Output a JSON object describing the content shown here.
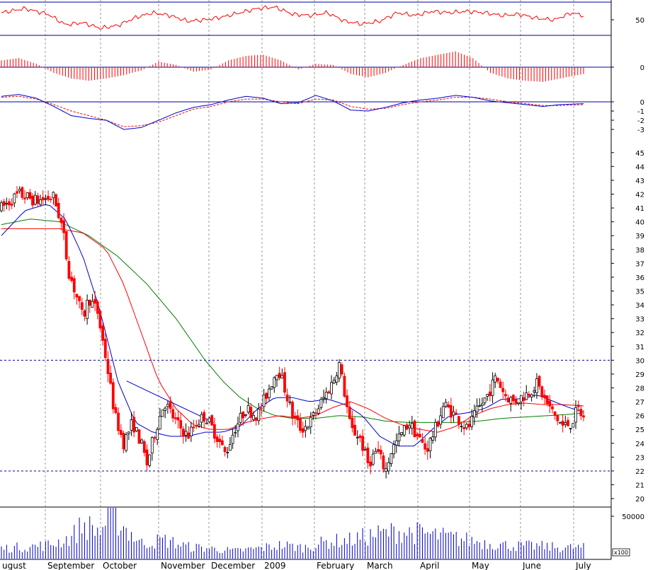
{
  "chart_data": {
    "type": "candlestick",
    "months": [
      "ugust",
      "September",
      "October",
      "November",
      "December",
      "2009",
      "February",
      "March",
      "April",
      "May",
      "June",
      "July"
    ],
    "price_axis": {
      "range": [
        19.8,
        45.5
      ],
      "ticks": [
        "45",
        "44",
        "43",
        "42",
        "41",
        "40",
        "39",
        "38",
        "37",
        "36",
        "35",
        "34",
        "33",
        "32",
        "31",
        "30",
        "29",
        "28",
        "27",
        "26",
        "25",
        "24",
        "23",
        "22",
        "21",
        "20"
      ],
      "support": 22,
      "resistance": 30
    },
    "price_path": [
      {
        "t": 0,
        "v": 41.0
      },
      {
        "t": 3,
        "v": 42.0
      },
      {
        "t": 6,
        "v": 41.5
      },
      {
        "t": 9,
        "v": 41.8
      },
      {
        "t": 10.5,
        "v": 39.5
      },
      {
        "t": 11.5,
        "v": 36.5
      },
      {
        "t": 13,
        "v": 34.5
      },
      {
        "t": 14,
        "v": 33.0
      },
      {
        "t": 15,
        "v": 34.5
      },
      {
        "t": 16.5,
        "v": 33.5
      },
      {
        "t": 18,
        "v": 30.0
      },
      {
        "t": 19.5,
        "v": 26.0
      },
      {
        "t": 21,
        "v": 24.0
      },
      {
        "t": 22.5,
        "v": 25.5
      },
      {
        "t": 24,
        "v": 24.0
      },
      {
        "t": 25,
        "v": 22.5
      },
      {
        "t": 26.5,
        "v": 25.0
      },
      {
        "t": 28,
        "v": 27.0
      },
      {
        "t": 30,
        "v": 25.5
      },
      {
        "t": 32,
        "v": 24.5
      },
      {
        "t": 33.5,
        "v": 25.5
      },
      {
        "t": 35,
        "v": 26.0
      },
      {
        "t": 37,
        "v": 24.5
      },
      {
        "t": 38.5,
        "v": 23.2
      },
      {
        "t": 40,
        "v": 25.0
      },
      {
        "t": 42,
        "v": 26.5
      },
      {
        "t": 44,
        "v": 26.0
      },
      {
        "t": 46,
        "v": 28.0
      },
      {
        "t": 47.5,
        "v": 29.5
      },
      {
        "t": 49,
        "v": 27.5
      },
      {
        "t": 50,
        "v": 26.0
      },
      {
        "t": 51.5,
        "v": 25.0
      },
      {
        "t": 53,
        "v": 25.5
      },
      {
        "t": 55,
        "v": 27.0
      },
      {
        "t": 57,
        "v": 28.5
      },
      {
        "t": 58,
        "v": 29.8
      },
      {
        "t": 59,
        "v": 27.5
      },
      {
        "t": 60,
        "v": 25.0
      },
      {
        "t": 61.5,
        "v": 24.5
      },
      {
        "t": 63,
        "v": 22.5
      },
      {
        "t": 64.5,
        "v": 23.5
      },
      {
        "t": 66,
        "v": 22.0
      },
      {
        "t": 67,
        "v": 23.5
      },
      {
        "t": 68.5,
        "v": 24.5
      },
      {
        "t": 70,
        "v": 25.5
      },
      {
        "t": 71.5,
        "v": 24.5
      },
      {
        "t": 73,
        "v": 23.5
      },
      {
        "t": 74.5,
        "v": 25.0
      },
      {
        "t": 76,
        "v": 26.8
      },
      {
        "t": 78,
        "v": 26.0
      },
      {
        "t": 80,
        "v": 25.0
      },
      {
        "t": 82,
        "v": 26.5
      },
      {
        "t": 83.5,
        "v": 27.5
      },
      {
        "t": 85,
        "v": 28.8
      },
      {
        "t": 86.5,
        "v": 27.5
      },
      {
        "t": 88,
        "v": 27.0
      },
      {
        "t": 90,
        "v": 27.5
      },
      {
        "t": 92,
        "v": 28.3
      },
      {
        "t": 93.5,
        "v": 27.0
      },
      {
        "t": 95,
        "v": 26.0
      },
      {
        "t": 96.5,
        "v": 25.2
      },
      {
        "t": 98,
        "v": 25.5
      },
      {
        "t": 99,
        "v": 26.5
      },
      {
        "t": 100,
        "v": 25.8
      }
    ],
    "ma_short": [
      {
        "t": 0,
        "v": 39.0
      },
      {
        "t": 4,
        "v": 40.8
      },
      {
        "t": 8,
        "v": 41.3
      },
      {
        "t": 11,
        "v": 40.2
      },
      {
        "t": 14,
        "v": 37.5
      },
      {
        "t": 17,
        "v": 33.5
      },
      {
        "t": 20,
        "v": 28.5
      },
      {
        "t": 23,
        "v": 25.5
      },
      {
        "t": 26,
        "v": 24.8
      },
      {
        "t": 29,
        "v": 24.5
      },
      {
        "t": 32,
        "v": 24.5
      },
      {
        "t": 35,
        "v": 24.8
      },
      {
        "t": 38,
        "v": 24.8
      },
      {
        "t": 41,
        "v": 25.2
      },
      {
        "t": 44,
        "v": 26.5
      },
      {
        "t": 47,
        "v": 27.3
      },
      {
        "t": 50,
        "v": 27.3
      },
      {
        "t": 53,
        "v": 27.0
      },
      {
        "t": 56,
        "v": 27.2
      },
      {
        "t": 59,
        "v": 26.8
      },
      {
        "t": 62,
        "v": 26.0
      },
      {
        "t": 65,
        "v": 24.5
      },
      {
        "t": 68,
        "v": 23.8
      },
      {
        "t": 71,
        "v": 23.8
      },
      {
        "t": 74,
        "v": 25.0
      },
      {
        "t": 77,
        "v": 26.0
      },
      {
        "t": 80,
        "v": 26.2
      },
      {
        "t": 83,
        "v": 26.5
      },
      {
        "t": 86,
        "v": 27.2
      },
      {
        "t": 89,
        "v": 27.2
      },
      {
        "t": 92,
        "v": 27.5
      },
      {
        "t": 95,
        "v": 27.0
      },
      {
        "t": 98,
        "v": 26.5
      },
      {
        "t": 100,
        "v": 26.3
      }
    ],
    "ma_mid": [
      {
        "t": 0,
        "v": 39.5
      },
      {
        "t": 5,
        "v": 39.5
      },
      {
        "t": 10,
        "v": 39.5
      },
      {
        "t": 14,
        "v": 39.2
      },
      {
        "t": 18,
        "v": 38.0
      },
      {
        "t": 21,
        "v": 35.5
      },
      {
        "t": 24,
        "v": 32.0
      },
      {
        "t": 27,
        "v": 28.5
      },
      {
        "t": 30,
        "v": 26.5
      },
      {
        "t": 33,
        "v": 25.3
      },
      {
        "t": 36,
        "v": 25.0
      },
      {
        "t": 39,
        "v": 25.0
      },
      {
        "t": 42,
        "v": 25.5
      },
      {
        "t": 45,
        "v": 25.8
      },
      {
        "t": 48,
        "v": 26.0
      },
      {
        "t": 51,
        "v": 25.8
      },
      {
        "t": 54,
        "v": 26.0
      },
      {
        "t": 57,
        "v": 26.6
      },
      {
        "t": 60,
        "v": 27.0
      },
      {
        "t": 63,
        "v": 26.5
      },
      {
        "t": 66,
        "v": 25.8
      },
      {
        "t": 69,
        "v": 25.3
      },
      {
        "t": 72,
        "v": 25.0
      },
      {
        "t": 75,
        "v": 24.8
      },
      {
        "t": 78,
        "v": 25.2
      },
      {
        "t": 81,
        "v": 26.0
      },
      {
        "t": 84,
        "v": 26.5
      },
      {
        "t": 87,
        "v": 26.8
      },
      {
        "t": 90,
        "v": 26.9
      },
      {
        "t": 93,
        "v": 26.8
      },
      {
        "t": 96,
        "v": 26.8
      },
      {
        "t": 100,
        "v": 26.7
      }
    ],
    "ma_long": [
      {
        "t": 0,
        "v": 39.8
      },
      {
        "t": 5,
        "v": 40.2
      },
      {
        "t": 10,
        "v": 40.0
      },
      {
        "t": 15,
        "v": 39.0
      },
      {
        "t": 20,
        "v": 37.5
      },
      {
        "t": 25,
        "v": 35.5
      },
      {
        "t": 30,
        "v": 33.0
      },
      {
        "t": 35,
        "v": 30.0
      },
      {
        "t": 38,
        "v": 28.5
      },
      {
        "t": 41,
        "v": 27.3
      },
      {
        "t": 44,
        "v": 26.5
      },
      {
        "t": 47,
        "v": 26.0
      },
      {
        "t": 50,
        "v": 25.8
      },
      {
        "t": 54,
        "v": 25.8
      },
      {
        "t": 58,
        "v": 26.0
      },
      {
        "t": 62,
        "v": 25.9
      },
      {
        "t": 66,
        "v": 25.6
      },
      {
        "t": 70,
        "v": 25.5
      },
      {
        "t": 74,
        "v": 25.5
      },
      {
        "t": 78,
        "v": 25.5
      },
      {
        "t": 82,
        "v": 25.6
      },
      {
        "t": 86,
        "v": 25.8
      },
      {
        "t": 90,
        "v": 25.9
      },
      {
        "t": 94,
        "v": 26.0
      },
      {
        "t": 98,
        "v": 26.1
      },
      {
        "t": 100,
        "v": 26.2
      }
    ],
    "trendline": {
      "from": {
        "t": 21.5,
        "v": 28.5
      },
      "to": {
        "t": 36.5,
        "v": 25.5
      }
    },
    "rsi": {
      "levels": [
        "50"
      ],
      "path": [
        {
          "t": 0,
          "v": 62
        },
        {
          "t": 4,
          "v": 68
        },
        {
          "t": 8,
          "v": 60
        },
        {
          "t": 11,
          "v": 45
        },
        {
          "t": 14,
          "v": 48
        },
        {
          "t": 17,
          "v": 40
        },
        {
          "t": 20,
          "v": 44
        },
        {
          "t": 23,
          "v": 55
        },
        {
          "t": 26,
          "v": 62
        },
        {
          "t": 29,
          "v": 58
        },
        {
          "t": 32,
          "v": 50
        },
        {
          "t": 35,
          "v": 52
        },
        {
          "t": 38,
          "v": 56
        },
        {
          "t": 41,
          "v": 62
        },
        {
          "t": 44,
          "v": 68
        },
        {
          "t": 47,
          "v": 70
        },
        {
          "t": 50,
          "v": 60
        },
        {
          "t": 53,
          "v": 58
        },
        {
          "t": 56,
          "v": 62
        },
        {
          "t": 59,
          "v": 50
        },
        {
          "t": 62,
          "v": 46
        },
        {
          "t": 65,
          "v": 50
        },
        {
          "t": 68,
          "v": 62
        },
        {
          "t": 71,
          "v": 58
        },
        {
          "t": 74,
          "v": 64
        },
        {
          "t": 77,
          "v": 62
        },
        {
          "t": 80,
          "v": 64
        },
        {
          "t": 83,
          "v": 62
        },
        {
          "t": 86,
          "v": 58
        },
        {
          "t": 89,
          "v": 60
        },
        {
          "t": 92,
          "v": 54
        },
        {
          "t": 95,
          "v": 52
        },
        {
          "t": 98,
          "v": 62
        },
        {
          "t": 100,
          "v": 58
        }
      ]
    },
    "macd_hist": {
      "levels": [
        "0"
      ],
      "path": [
        {
          "t": 0,
          "v": 0.6
        },
        {
          "t": 3,
          "v": 0.8
        },
        {
          "t": 6,
          "v": 0.3
        },
        {
          "t": 9,
          "v": -0.5
        },
        {
          "t": 12,
          "v": -1.0
        },
        {
          "t": 15,
          "v": -1.2
        },
        {
          "t": 18,
          "v": -1.0
        },
        {
          "t": 21,
          "v": -0.7
        },
        {
          "t": 24,
          "v": -0.3
        },
        {
          "t": 27,
          "v": 0.5
        },
        {
          "t": 30,
          "v": 0.2
        },
        {
          "t": 33,
          "v": -0.4
        },
        {
          "t": 36,
          "v": -0.2
        },
        {
          "t": 39,
          "v": 0.6
        },
        {
          "t": 42,
          "v": 1.0
        },
        {
          "t": 45,
          "v": 1.1
        },
        {
          "t": 48,
          "v": 0.6
        },
        {
          "t": 51,
          "v": -0.2
        },
        {
          "t": 54,
          "v": 0.3
        },
        {
          "t": 57,
          "v": 0.2
        },
        {
          "t": 60,
          "v": -0.6
        },
        {
          "t": 63,
          "v": -0.9
        },
        {
          "t": 66,
          "v": -0.5
        },
        {
          "t": 69,
          "v": 0.2
        },
        {
          "t": 72,
          "v": 0.8
        },
        {
          "t": 75,
          "v": 1.1
        },
        {
          "t": 78,
          "v": 1.4
        },
        {
          "t": 81,
          "v": 0.8
        },
        {
          "t": 84,
          "v": -0.5
        },
        {
          "t": 87,
          "v": -1.0
        },
        {
          "t": 90,
          "v": -1.2
        },
        {
          "t": 93,
          "v": -1.3
        },
        {
          "t": 96,
          "v": -1.0
        },
        {
          "t": 100,
          "v": -0.6
        }
      ]
    },
    "macd": {
      "ticks": [
        "0",
        "-1",
        "-2",
        "-3"
      ],
      "line": [
        {
          "t": 0,
          "v": 0.6
        },
        {
          "t": 3,
          "v": 0.8
        },
        {
          "t": 6,
          "v": 0.4
        },
        {
          "t": 9,
          "v": -0.5
        },
        {
          "t": 12,
          "v": -1.5
        },
        {
          "t": 15,
          "v": -1.8
        },
        {
          "t": 18,
          "v": -2.0
        },
        {
          "t": 21,
          "v": -3.0
        },
        {
          "t": 24,
          "v": -2.8
        },
        {
          "t": 27,
          "v": -2.0
        },
        {
          "t": 30,
          "v": -1.2
        },
        {
          "t": 33,
          "v": -0.6
        },
        {
          "t": 36,
          "v": -0.3
        },
        {
          "t": 39,
          "v": 0.2
        },
        {
          "t": 42,
          "v": 0.6
        },
        {
          "t": 45,
          "v": 0.4
        },
        {
          "t": 48,
          "v": -0.2
        },
        {
          "t": 51,
          "v": -0.1
        },
        {
          "t": 54,
          "v": 0.7
        },
        {
          "t": 57,
          "v": 0.1
        },
        {
          "t": 60,
          "v": -0.9
        },
        {
          "t": 63,
          "v": -1.0
        },
        {
          "t": 66,
          "v": -0.6
        },
        {
          "t": 69,
          "v": -0.1
        },
        {
          "t": 72,
          "v": 0.2
        },
        {
          "t": 75,
          "v": 0.4
        },
        {
          "t": 78,
          "v": 0.7
        },
        {
          "t": 81,
          "v": 0.5
        },
        {
          "t": 84,
          "v": 0.1
        },
        {
          "t": 87,
          "v": -0.1
        },
        {
          "t": 90,
          "v": -0.3
        },
        {
          "t": 93,
          "v": -0.5
        },
        {
          "t": 96,
          "v": -0.3
        },
        {
          "t": 100,
          "v": -0.2
        }
      ],
      "signal": [
        {
          "t": 0,
          "v": 0.5
        },
        {
          "t": 3,
          "v": 0.6
        },
        {
          "t": 6,
          "v": 0.3
        },
        {
          "t": 9,
          "v": -0.3
        },
        {
          "t": 12,
          "v": -1.0
        },
        {
          "t": 15,
          "v": -1.5
        },
        {
          "t": 18,
          "v": -2.0
        },
        {
          "t": 21,
          "v": -2.7
        },
        {
          "t": 24,
          "v": -2.6
        },
        {
          "t": 27,
          "v": -2.2
        },
        {
          "t": 30,
          "v": -1.5
        },
        {
          "t": 33,
          "v": -0.8
        },
        {
          "t": 36,
          "v": -0.5
        },
        {
          "t": 39,
          "v": 0.0
        },
        {
          "t": 42,
          "v": 0.3
        },
        {
          "t": 45,
          "v": 0.3
        },
        {
          "t": 48,
          "v": 0.0
        },
        {
          "t": 51,
          "v": -0.2
        },
        {
          "t": 54,
          "v": 0.3
        },
        {
          "t": 57,
          "v": 0.2
        },
        {
          "t": 60,
          "v": -0.5
        },
        {
          "t": 63,
          "v": -0.8
        },
        {
          "t": 66,
          "v": -0.7
        },
        {
          "t": 69,
          "v": -0.3
        },
        {
          "t": 72,
          "v": 0.0
        },
        {
          "t": 75,
          "v": 0.2
        },
        {
          "t": 78,
          "v": 0.5
        },
        {
          "t": 81,
          "v": 0.5
        },
        {
          "t": 84,
          "v": 0.3
        },
        {
          "t": 87,
          "v": 0.0
        },
        {
          "t": 90,
          "v": -0.2
        },
        {
          "t": 93,
          "v": -0.4
        },
        {
          "t": 96,
          "v": -0.4
        },
        {
          "t": 100,
          "v": -0.3
        }
      ]
    },
    "volume": {
      "tick": "50000",
      "unit": "x100",
      "max": 60000,
      "levels": [
        {
          "t": 0,
          "v": 12000
        },
        {
          "t": 8,
          "v": 16000
        },
        {
          "t": 12,
          "v": 25000
        },
        {
          "t": 14,
          "v": 40000
        },
        {
          "t": 17,
          "v": 32000
        },
        {
          "t": 19,
          "v": 55000
        },
        {
          "t": 21,
          "v": 38000
        },
        {
          "t": 24,
          "v": 18000
        },
        {
          "t": 28,
          "v": 22000
        },
        {
          "t": 32,
          "v": 14000
        },
        {
          "t": 36,
          "v": 12000
        },
        {
          "t": 40,
          "v": 9000
        },
        {
          "t": 44,
          "v": 12000
        },
        {
          "t": 48,
          "v": 16000
        },
        {
          "t": 52,
          "v": 13000
        },
        {
          "t": 56,
          "v": 20000
        },
        {
          "t": 60,
          "v": 22000
        },
        {
          "t": 64,
          "v": 28000
        },
        {
          "t": 68,
          "v": 32000
        },
        {
          "t": 72,
          "v": 30000
        },
        {
          "t": 76,
          "v": 26000
        },
        {
          "t": 80,
          "v": 22000
        },
        {
          "t": 84,
          "v": 18000
        },
        {
          "t": 88,
          "v": 15000
        },
        {
          "t": 92,
          "v": 15000
        },
        {
          "t": 96,
          "v": 13000
        },
        {
          "t": 100,
          "v": 13000
        }
      ]
    },
    "colors": {
      "up": "#000000",
      "down": "#ff0000",
      "ma_short": "#0000cc",
      "ma_mid": "#ff0000",
      "ma_long": "#008000",
      "level_line": "#0000a0",
      "grid": "#999999"
    }
  }
}
